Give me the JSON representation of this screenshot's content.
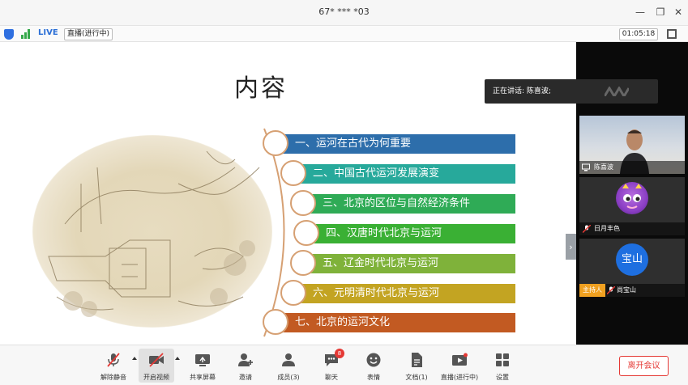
{
  "window": {
    "title": "67* *** *03",
    "minimize_icon": "minimize-icon",
    "restore_icon": "restore-icon",
    "close_icon": "close-icon"
  },
  "statusbar": {
    "live_label": "LIVE",
    "live_status": "直播(进行中)",
    "timer": "01:05:18"
  },
  "slide": {
    "title": "内容",
    "items": [
      {
        "text": "一、运河在古代为何重要",
        "color": "#2d6eab"
      },
      {
        "text": "二、中国古代运河发展演变",
        "color": "#27a99b"
      },
      {
        "text": "三、北京的区位与自然经济条件",
        "color": "#2fab56"
      },
      {
        "text": "四、汉唐时代北京与运河",
        "color": "#3ab034"
      },
      {
        "text": "五、辽金时代北京与运河",
        "color": "#7fb23a"
      },
      {
        "text": "六、元明清时代北京与运河",
        "color": "#c3a422"
      },
      {
        "text": "七、北京的运河文化",
        "color": "#c25a22"
      }
    ]
  },
  "speaking": {
    "text": "正在讲话: 陈喜波;"
  },
  "participants": [
    {
      "name": "陈喜波",
      "type": "camera"
    },
    {
      "name": "日月丰色",
      "type": "avatar"
    },
    {
      "name": "尚宝山",
      "type": "avatar",
      "avatar_text": "宝山",
      "host_badge": "主持人"
    }
  ],
  "toolbar": {
    "unmute": "解除静音",
    "start_video": "开启视频",
    "share_screen": "共享屏幕",
    "invite": "邀请",
    "members": "成员(3)",
    "chat": "聊天",
    "chat_badge": "8",
    "reactions": "表情",
    "docs": "文档(1)",
    "live": "直播(进行中)",
    "settings": "设置",
    "leave": "离开会议"
  },
  "colors": {
    "accent": "#2b6fd6",
    "danger": "#e53935",
    "host": "#f0a020"
  }
}
